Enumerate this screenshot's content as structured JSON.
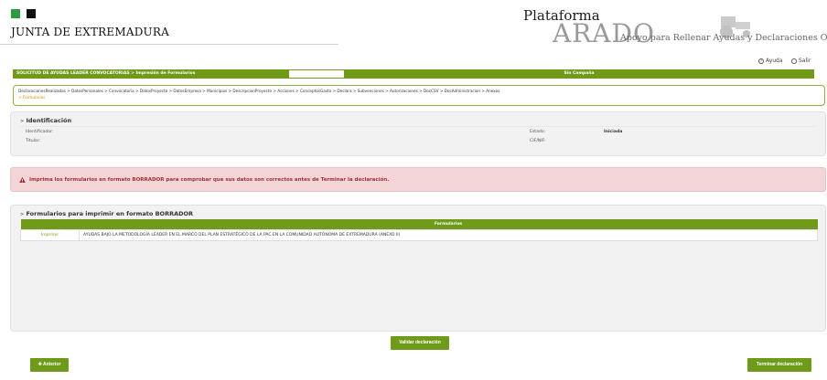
{
  "header": {
    "org_name": "JUNTA DE EXTREMADURA",
    "brand_top": "Plataforma",
    "brand_big": "ARADO",
    "brand_sub": "Apoyo para Rellenar Ayudas y Declaraciones On-line"
  },
  "util": {
    "help_label": "Ayuda",
    "exit_label": "Salir"
  },
  "bars": {
    "left_text": "SOLICITUD DE AYUDAS LEADER CONVOCATORIAS > Impresión de Formularios",
    "right_text": "Sin Campaña"
  },
  "breadcrumb": {
    "trail": "DeclaracionesRealizadas > DatosPersonales > Convocatoria > DatosProyecto > DatosEmpresa > Municipios > DescripcionProyecto > Acciones > ConceptosGasto > Declara > Subvenciones > Autorizaciones > DocCSV > DocAdministracion > Anexos",
    "current": "> Formularios"
  },
  "identificacion": {
    "title": "Identificación",
    "identificador_label": "Identificador:",
    "titular_label": "Titular:",
    "estado_label": "Estado:",
    "estado_value": "Iniciada",
    "cif_label": "CIF/NIF:"
  },
  "alert": {
    "text": "Imprima los formularios en formato BORRADOR para comprobar que sus datos son correctos antes de Terminar la declaración."
  },
  "formularios": {
    "title": "Formularios para imprimir en formato BORRADOR",
    "column_header": "Formularios",
    "rows": [
      {
        "action": "Imprimir",
        "description": "AYUDAS BAJO LA METODOLOGÍA LEADER EN EL MARCO DEL PLAN ESTRATÉGICO DE LA PAC EN LA COMUNIDAD AUTÓNOMA DE EXTREMADURA (ANEXO II)"
      }
    ]
  },
  "buttons": {
    "validate": "Validar declaración",
    "previous": "Anterior",
    "finish": "Terminar declaración"
  },
  "colors": {
    "accent": "#6f9a1a",
    "alert_bg": "#f3d5d8",
    "alert_text": "#a03030"
  }
}
